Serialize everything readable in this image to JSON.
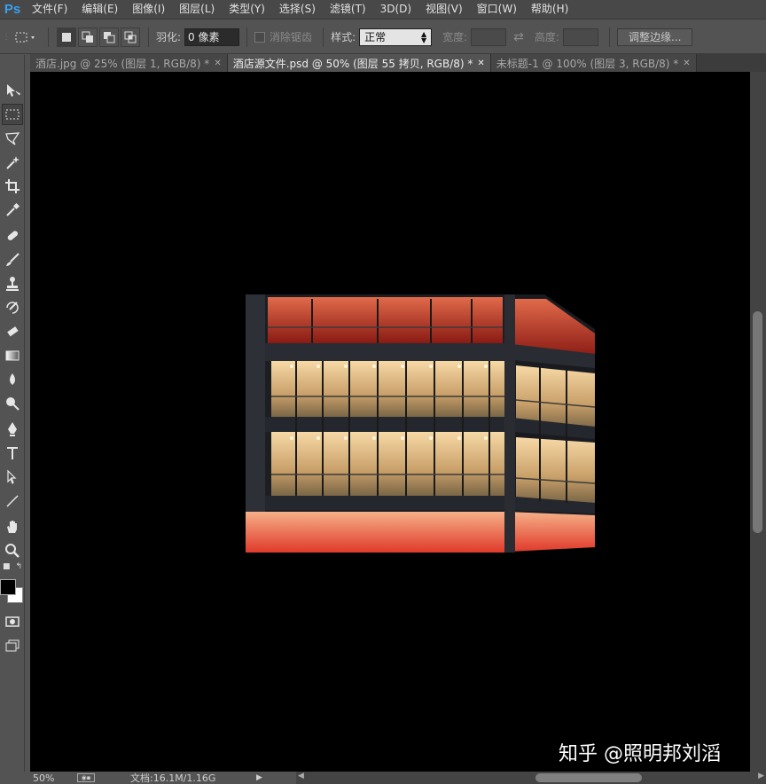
{
  "app": {
    "logo": "Ps"
  },
  "menu": [
    "文件(F)",
    "编辑(E)",
    "图像(I)",
    "图层(L)",
    "类型(Y)",
    "选择(S)",
    "滤镜(T)",
    "3D(D)",
    "视图(V)",
    "窗口(W)",
    "帮助(H)"
  ],
  "options": {
    "feather_label": "羽化:",
    "feather_value": "0 像素",
    "antialias_label": "消除锯齿",
    "style_label": "样式:",
    "style_value": "正常",
    "width_label": "宽度:",
    "height_label": "高度:",
    "refine_edge_label": "调整边缘..."
  },
  "tabs": [
    {
      "title": "酒店.jpg @ 25% (图层 1, RGB/8) *",
      "active": false
    },
    {
      "title": "酒店源文件.psd @ 50% (图层 55 拷贝, RGB/8) *",
      "active": true
    },
    {
      "title": "未标题-1 @ 100% (图层 3, RGB/8) *",
      "active": false
    }
  ],
  "tools": [
    "move-tool",
    "marquee-tool",
    "lasso-tool",
    "magic-wand-tool",
    "crop-tool",
    "eyedropper-tool",
    "healing-brush-tool",
    "brush-tool",
    "clone-stamp-tool",
    "history-brush-tool",
    "eraser-tool",
    "gradient-tool",
    "blur-tool",
    "dodge-tool",
    "pen-tool",
    "type-tool",
    "path-selection-tool",
    "line-tool",
    "hand-tool",
    "zoom-tool"
  ],
  "status": {
    "zoom": "50%",
    "doc_info": "文档:16.1M/1.16G"
  },
  "watermark": "知乎 @照明邦刘滔",
  "colors": {
    "foreground": "#000000",
    "background": "#ffffff"
  }
}
